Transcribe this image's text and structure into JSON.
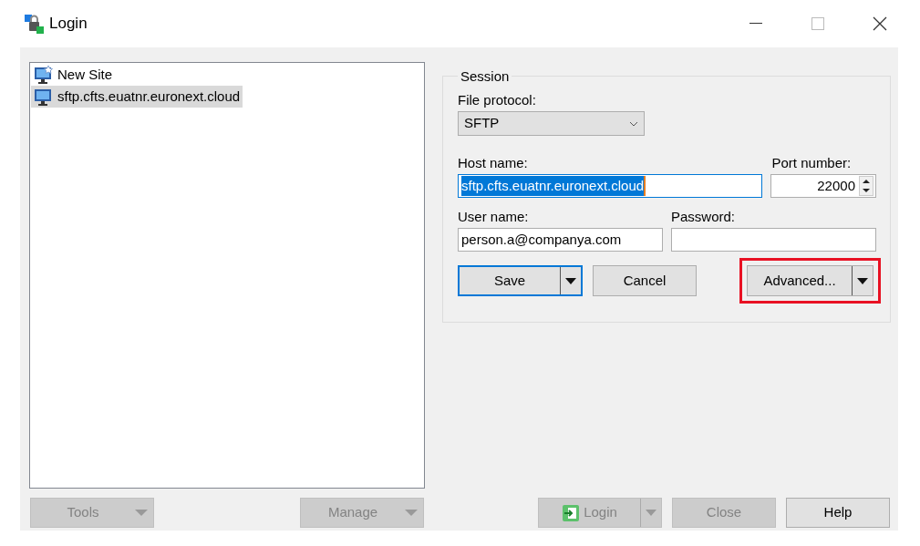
{
  "window": {
    "title": "Login"
  },
  "sites": [
    {
      "label": "New Site",
      "kind": "new",
      "selected": false
    },
    {
      "label": "sftp.cfts.euatnr.euronext.cloud",
      "kind": "site",
      "selected": true
    }
  ],
  "session": {
    "legend": "Session",
    "file_protocol": {
      "label": "File protocol:",
      "value": "SFTP"
    },
    "host": {
      "label": "Host name:",
      "value": "sftp.cfts.euatnr.euronext.cloud",
      "selected": true
    },
    "port": {
      "label": "Port number:",
      "value": "22000"
    },
    "user": {
      "label": "User name:",
      "value": "person.a@companya.com"
    },
    "password": {
      "label": "Password:"
    },
    "buttons": [
      {
        "label": "Save",
        "kind": "split",
        "default": true,
        "highlighted": false
      },
      {
        "label": "Cancel",
        "kind": "plain",
        "default": false,
        "highlighted": false
      },
      {
        "label": "Advanced...",
        "kind": "split",
        "default": false,
        "highlighted": true
      }
    ]
  },
  "bottom_buttons": [
    {
      "label": "Tools",
      "kind": "menu",
      "disabled": true
    },
    {
      "label": "Manage",
      "kind": "menu",
      "disabled": true
    },
    {
      "label": "Login",
      "kind": "login",
      "disabled": true
    },
    {
      "label": "Close",
      "kind": "plain",
      "disabled": true
    },
    {
      "label": "Help",
      "kind": "plain",
      "disabled": false
    }
  ]
}
